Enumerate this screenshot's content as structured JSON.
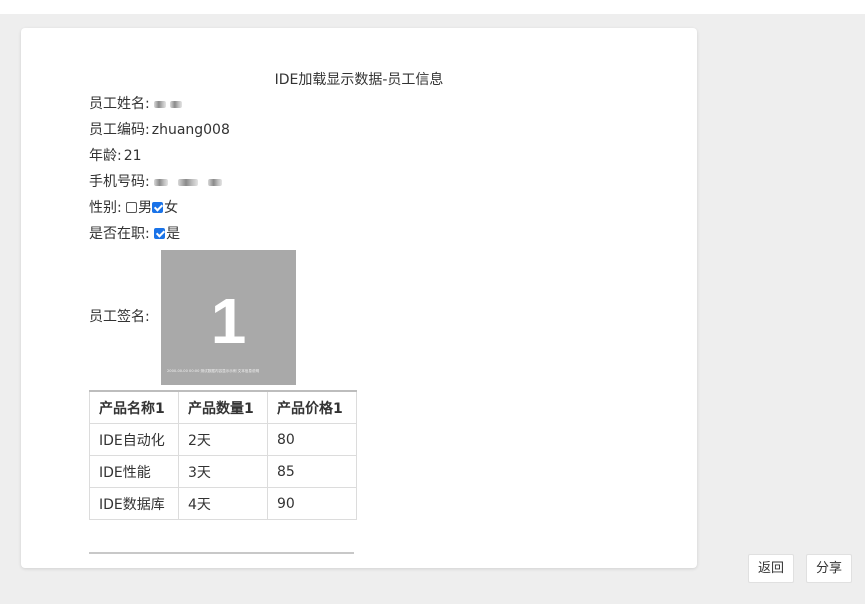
{
  "document": {
    "title": "IDE加载显示数据-员工信息",
    "fields": {
      "name_label": "员工姓名:",
      "id_label": "员工编码:",
      "id_value": "zhuang008",
      "age_label": "年龄:",
      "age_value": "21",
      "phone_label": "手机号码:",
      "gender_label": "性别:",
      "gender_options": [
        {
          "label": "男",
          "checked": false
        },
        {
          "label": "女",
          "checked": true
        }
      ],
      "employed_label": "是否在职:",
      "employed_option": {
        "label": "是",
        "checked": true
      }
    },
    "signature": {
      "label": "员工签名:",
      "image_number": "1",
      "image_caption": "2000-00-00 00:00 测试数据内容显示示例 文本信息说明"
    },
    "table": {
      "headers": [
        "产品名称1",
        "产品数量1",
        "产品价格1"
      ],
      "rows": [
        [
          "IDE自动化",
          "2天",
          "80"
        ],
        [
          "IDE性能",
          "3天",
          "85"
        ],
        [
          "IDE数据库",
          "4天",
          "90"
        ]
      ]
    }
  },
  "actions": {
    "back_label": "返回",
    "share_label": "分享"
  },
  "colors": {
    "page_background": "#eeeeee",
    "card_background": "#ffffff",
    "checkbox_checked": "#1a73e8",
    "signature_background": "#a9a9a9"
  }
}
